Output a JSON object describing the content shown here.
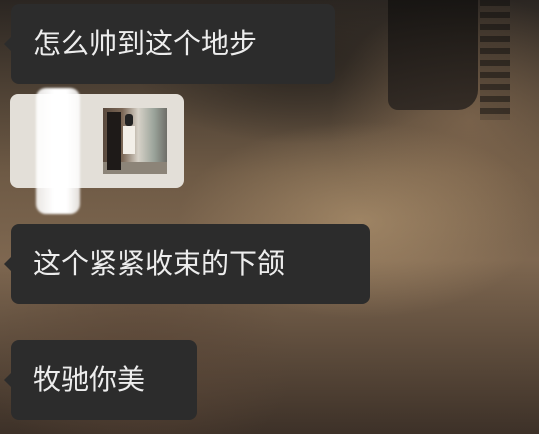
{
  "chat": {
    "messages": [
      {
        "type": "text",
        "text": "怎么帅到这个地步"
      },
      {
        "type": "image"
      },
      {
        "type": "text",
        "text": "这个紧紧收束的下颌"
      },
      {
        "type": "text",
        "text": "牧驰你美"
      }
    ]
  },
  "colors": {
    "bubble_background": "#2c2c2c",
    "bubble_text": "#ededed",
    "image_bubble_background": "#e3dfd8"
  }
}
